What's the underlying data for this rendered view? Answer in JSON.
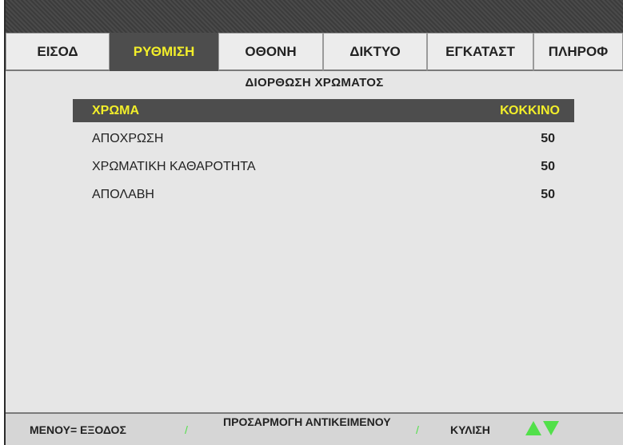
{
  "tabs": [
    {
      "label": "ΕΙΣΟΔ",
      "active": false
    },
    {
      "label": "ΡΥΘΜΙΣΗ",
      "active": true
    },
    {
      "label": "ΟΘΟΝΗ",
      "active": false
    },
    {
      "label": "ΔΙΚΤΥΟ",
      "active": false
    },
    {
      "label": "ΕΓΚΑΤΑΣΤ",
      "active": false
    },
    {
      "label": "ΠΛΗΡΟΦ",
      "active": false
    }
  ],
  "submenu_title": "ΔΙΟΡΘΩΣΗ ΧΡΩΜΑΤΟΣ",
  "items": [
    {
      "label": "ΧΡΩΜΑ",
      "value": "ΚΟΚΚΙΝΟ",
      "selected": true
    },
    {
      "label": "ΑΠΟΧΡΩΣΗ",
      "value": "50",
      "selected": false
    },
    {
      "label": "ΧΡΩΜΑΤΙΚΗ ΚΑΘΑΡΟΤΗΤΑ",
      "value": "50",
      "selected": false
    },
    {
      "label": "ΑΠΟΛΑΒΗ",
      "value": "50",
      "selected": false
    }
  ],
  "footer": {
    "exit": "ΜΕΝΟΥ= ΕΞΟΔΟΣ",
    "separator": "/",
    "adjust": "ΠΡΟΣΑΡΜΟΓΗ ΑΝΤΙΚΕΙΜΕΝΟΥ",
    "scroll": "ΚΥΛΙΣΗ",
    "scroll_icons": [
      "up-arrow-icon",
      "down-arrow-icon"
    ]
  },
  "colors": {
    "highlight_bg": "#4d4d4d",
    "highlight_text": "#f2ee2a",
    "arrow_green": "#52e04a",
    "panel_bg": "#e6e6e6"
  }
}
